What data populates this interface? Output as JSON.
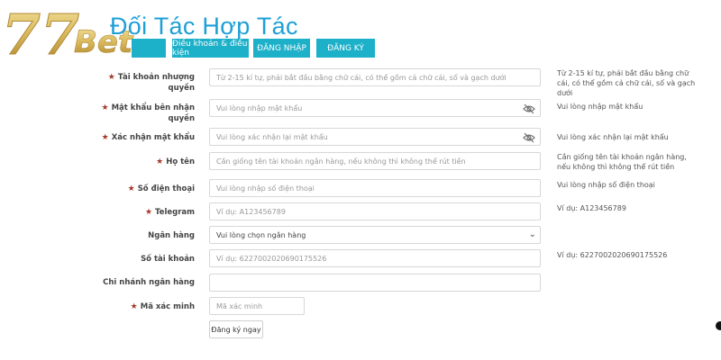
{
  "brand": {
    "logo_text": "77Bet"
  },
  "header": {
    "title": "Đối Tác Hợp Tác"
  },
  "nav": {
    "home": "",
    "terms": "Điều khoản & điều kiện",
    "login": "ĐĂNG NHẬP",
    "register": "ĐĂNG KÝ"
  },
  "form": {
    "rows": [
      {
        "label": "Tài khoản nhượng quyền",
        "required": true,
        "placeholder": "Từ 2-15 kí tự, phải bắt đầu bằng chữ cái, có thể  gồm cả chữ cái, số và gạch dưới",
        "hint": "Từ 2-15 kí tự, phải bắt đầu bằng chữ cái, có thể gồm cả chữ cái, số và gạch dưới"
      },
      {
        "label": "Mật khẩu bên nhận quyền",
        "required": true,
        "placeholder": "Vui lòng nhập mật khẩu",
        "hint": "Vui lòng nhập mật khẩu",
        "icon": "eye-slash-icon"
      },
      {
        "label": "Xác nhận mật khẩu",
        "required": true,
        "placeholder": "Vui lòng xác nhận lại mật khẩu",
        "hint": "Vui lòng xác nhận lại mật khẩu",
        "icon": "eye-slash-icon"
      },
      {
        "label": "Họ tên",
        "required": true,
        "placeholder": "Cần giống tên tài khoản ngân hàng, nếu không thì không thể rút tiền",
        "hint": "Cần giống tên tài khoản ngân hàng, nếu không thì không thể rút tiền"
      },
      {
        "label": "Số điện thoại",
        "required": true,
        "placeholder": "Vui lòng nhập số điện thoại",
        "hint": "Vui lòng nhập số điện thoại"
      },
      {
        "label": "Telegram",
        "required": true,
        "placeholder": "Ví dụ:   A123456789",
        "hint": "Ví dụ:    A123456789"
      },
      {
        "label": "Ngân hàng",
        "required": false,
        "value": "Vui lòng chọn ngân hàng",
        "hint": ""
      },
      {
        "label": "Số tài khoản",
        "required": false,
        "placeholder": "Ví dụ:   6227002020690175526",
        "hint": "Ví dụ:    6227002020690175526"
      },
      {
        "label": "Chi nhánh ngân hàng",
        "required": false,
        "placeholder": "",
        "hint": ""
      },
      {
        "label": "Mã xác minh",
        "required": true,
        "placeholder": "Mã xác minh",
        "hint": ""
      }
    ],
    "submit_label": "Đăng ký ngay"
  },
  "colors": {
    "accent": "#1db0c9",
    "title": "#1e9fd6",
    "required_star": "#a33a2a",
    "logo_gold": "#d9b85a"
  }
}
